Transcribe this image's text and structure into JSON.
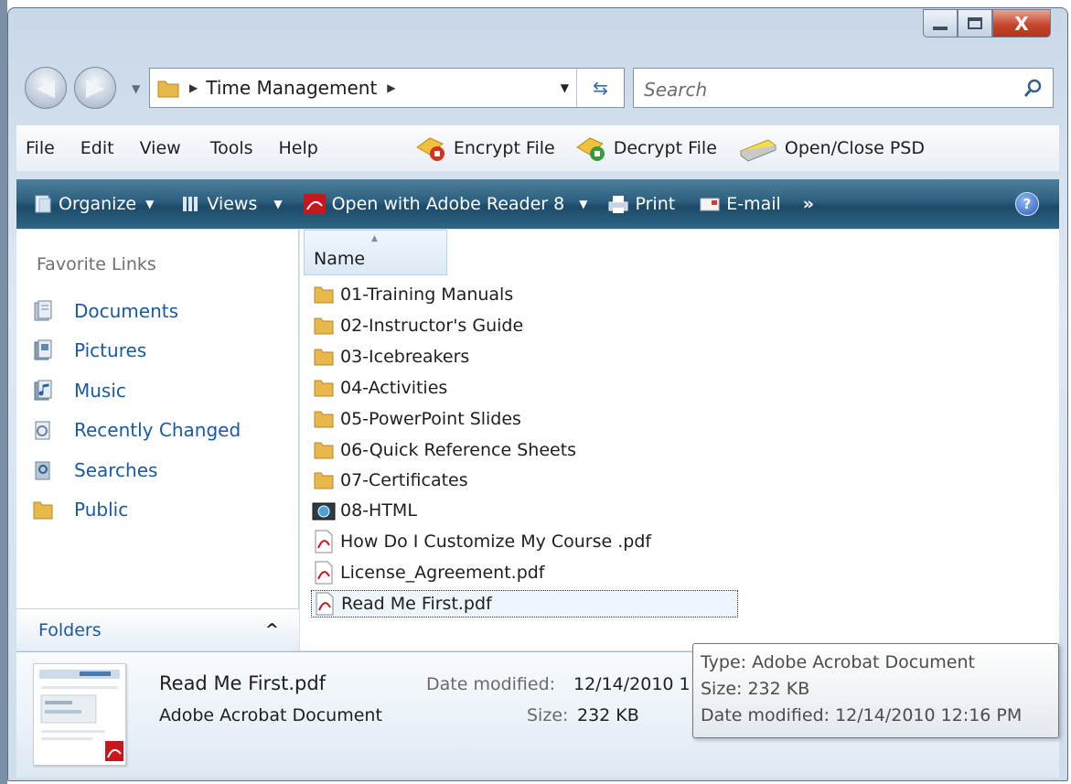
{
  "window": {
    "minimize_icon": "minimize-icon",
    "maximize_icon": "maximize-icon",
    "close_glyph": "X"
  },
  "address": {
    "crumb": "Time Management",
    "search_placeholder": "Search"
  },
  "menu": {
    "items": [
      "File",
      "Edit",
      "View",
      "Tools",
      "Help"
    ],
    "toolbar": [
      "Encrypt File",
      "Decrypt File",
      "Open/Close PSD"
    ]
  },
  "commands": {
    "organize": "Organize",
    "views": "Views",
    "open_with": "Open with Adobe Reader 8",
    "print": "Print",
    "email": "E-mail",
    "more": "»",
    "help": "?"
  },
  "nav": {
    "header": "Favorite Links",
    "links": [
      "Documents",
      "Pictures",
      "Music",
      "Recently Changed",
      "Searches",
      "Public"
    ],
    "folders_label": "Folders"
  },
  "files": {
    "column": "Name",
    "rows": [
      {
        "name": "01-Training Manuals",
        "kind": "folder"
      },
      {
        "name": "02-Instructor's Guide",
        "kind": "folder"
      },
      {
        "name": "03-Icebreakers",
        "kind": "folder"
      },
      {
        "name": "04-Activities",
        "kind": "folder"
      },
      {
        "name": "05-PowerPoint Slides",
        "kind": "folder"
      },
      {
        "name": "06-Quick Reference Sheets",
        "kind": "folder"
      },
      {
        "name": "07-Certificates",
        "kind": "folder"
      },
      {
        "name": "08-HTML",
        "kind": "html"
      },
      {
        "name": "How Do I Customize My Course .pdf",
        "kind": "pdf"
      },
      {
        "name": "License_Agreement.pdf",
        "kind": "pdf"
      },
      {
        "name": "Read Me First.pdf",
        "kind": "pdf",
        "selected": true
      }
    ]
  },
  "details": {
    "name": "Read Me First.pdf",
    "type": "Adobe Acrobat Document",
    "date_label": "Date modified:",
    "date_value": "12/14/2010 1",
    "size_label": "Size:",
    "size_value": "232 KB"
  },
  "tooltip": {
    "line1": "Type: Adobe Acrobat Document",
    "line2": "Size: 232 KB",
    "line3": "Date modified: 12/14/2010 12:16 PM"
  },
  "colors": {
    "link": "#1a5aa3",
    "command_bar": "#2c5f7f",
    "close_button": "#c6472d",
    "folder": "#e8b84a",
    "pdf": "#c8161d"
  }
}
